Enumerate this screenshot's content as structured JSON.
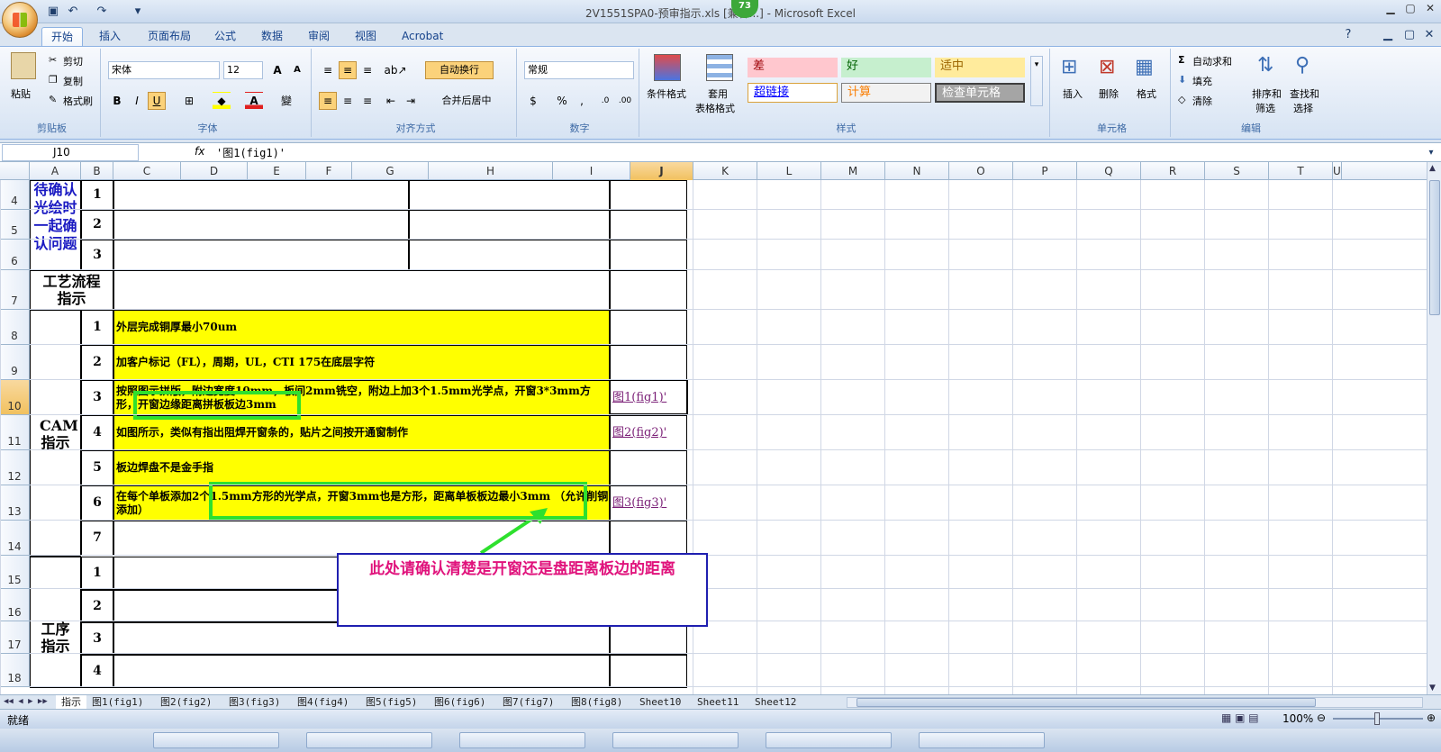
{
  "window": {
    "title": "2V1551SPA0-预审指示.xls  [兼容...] - Microsoft Excel",
    "badge": "73"
  },
  "tabs": [
    "开始",
    "插入",
    "页面布局",
    "公式",
    "数据",
    "审阅",
    "视图",
    "Acrobat"
  ],
  "ribbon": {
    "clipboard": {
      "paste": "粘贴",
      "cut": "剪切",
      "copy": "复制",
      "format_painter": "格式刷",
      "label": "剪贴板"
    },
    "font": {
      "name": "宋体",
      "size": "12",
      "label": "字体"
    },
    "align": {
      "wrap": "自动换行",
      "merge": "合并后居中",
      "label": "对齐方式"
    },
    "number": {
      "format": "常规",
      "label": "数字"
    },
    "styles": {
      "cond": "条件格式",
      "table": "套用",
      "table2": "表格格式",
      "bad": "差",
      "good": "好",
      "neutral": "适中",
      "hyperlink": "超链接",
      "calc": "计算",
      "check": "检查单元格",
      "label": "样式"
    },
    "cells": {
      "insert": "插入",
      "delete": "删除",
      "format": "格式",
      "label": "单元格"
    },
    "editing": {
      "autosum": "自动求和",
      "fill": "填充",
      "clear": "清除",
      "sort": "排序和",
      "sort2": "筛选",
      "find": "查找和",
      "find2": "选择",
      "label": "编辑"
    }
  },
  "formula_bar": {
    "name_box": "J10",
    "fx": "fx",
    "content": "'图1(fig1)'"
  },
  "columns": [
    "A",
    "B",
    "C",
    "D",
    "E",
    "F",
    "G",
    "H",
    "I",
    "J",
    "K",
    "L",
    "M",
    "N",
    "O",
    "P",
    "Q",
    "R",
    "S",
    "T",
    "U"
  ],
  "rows": [
    "4",
    "5",
    "6",
    "7",
    "8",
    "9",
    "10",
    "11",
    "12",
    "13",
    "14",
    "15",
    "16",
    "17",
    "18"
  ],
  "sheet": {
    "section1": "待确认光绘时一起确认问题",
    "section2": "工艺流程指示",
    "section3": "CAM指示",
    "section4": "工序指示",
    "nums1": [
      "1",
      "2",
      "3"
    ],
    "cam_items": [
      {
        "n": "1",
        "text": "外层完成铜厚最小70um",
        "link": ""
      },
      {
        "n": "2",
        "text": "加客户标记（FL），周期，UL，CTI 175在底层字符",
        "link": ""
      },
      {
        "n": "3",
        "text": "按照图示拼版，附边宽度10mm，板间2mm铣空，附边上加3个1.5mm光学点，开窗3*3mm方形，开窗边缘距离拼板板边3mm",
        "link": "图1(fig1)'"
      },
      {
        "n": "4",
        "text": "如图所示，类似有指出阻焊开窗条的，贴片之间按开通窗制作",
        "link": "图2(fig2)'"
      },
      {
        "n": "5",
        "text": "板边焊盘不是金手指",
        "link": ""
      },
      {
        "n": "6",
        "text": "在每个单板添加2个1.5mm方形的光学点，开窗3mm也是方形，距离单板板边最小3mm （允许削铜添加）",
        "link": "图3(fig3)'"
      },
      {
        "n": "7",
        "text": "",
        "link": ""
      }
    ],
    "nums4": [
      "1",
      "2",
      "3",
      "4"
    ]
  },
  "callout": "此处请确认清楚是开窗还是盘距离板边的距离",
  "sheet_tabs": [
    "指示",
    "图1(fig1)",
    "图2(fig2)",
    "图3(fig3)",
    "图4(fig4)",
    "图5(fig5)",
    "图6(fig6)",
    "图7(fig7)",
    "图8(fig8)",
    "Sheet10",
    "Sheet11",
    "Sheet12"
  ],
  "status": {
    "ready": "就绪",
    "zoom": "100%"
  },
  "colors": {
    "highlight": "#ffff00",
    "green_box": "#2ee02e",
    "callout_border": "#1f1fb0",
    "callout_text": "#e0137c"
  }
}
